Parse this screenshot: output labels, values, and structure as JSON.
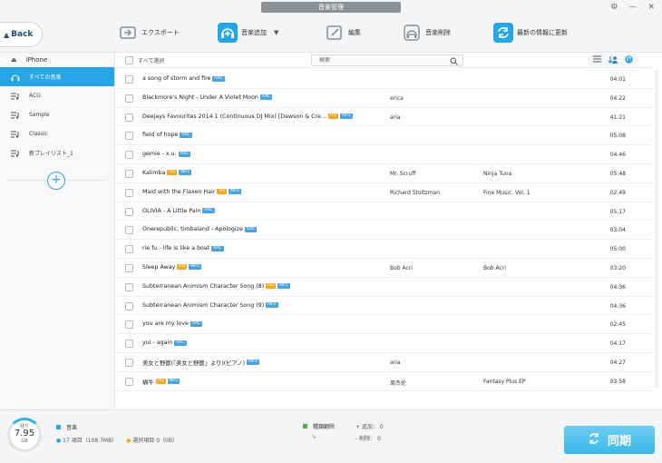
{
  "window": {
    "title": "音楽管理",
    "settings_glyph": "⚙",
    "minimize_glyph": "—",
    "close_glyph": "✕"
  },
  "toolbar": {
    "back_label": "Back",
    "export_label": "エクスポート",
    "add_label": "音楽追加",
    "edit_label": "編集",
    "delete_label": "音楽削除",
    "refresh_label": "最新の情報に更新",
    "accent_color": "#27a6e6"
  },
  "sidebar": {
    "device": "iPhone",
    "items": [
      {
        "label": "すべての音楽",
        "icon": "headphones-icon",
        "active": true
      },
      {
        "label": "ACG",
        "icon": "playlist-icon"
      },
      {
        "label": "Sample",
        "icon": "playlist-icon"
      },
      {
        "label": "Classic",
        "icon": "playlist-icon"
      },
      {
        "label": "新プレイリスト_1",
        "icon": "playlist-icon"
      }
    ],
    "add_glyph": "+"
  },
  "list": {
    "select_all": "すべて選択",
    "search_placeholder": "検索",
    "songs": [
      {
        "title": "a song of storm and fire",
        "badges": [
          "AAC"
        ],
        "artist": "",
        "album": "",
        "duration": "04:01"
      },
      {
        "title": "Blackmore's Night - Under A Violet Moon",
        "badges": [
          "AAC"
        ],
        "artist": "erica",
        "album": "",
        "duration": "04:22"
      },
      {
        "title": "Deejays Favourites 2014.1 (Continuous DJ Mix) [Dawson & Cre…",
        "badges": [
          "HQ",
          "MP3"
        ],
        "artist": "aria",
        "album": "",
        "duration": "41:21"
      },
      {
        "title": "field of hope",
        "badges": [
          "AAC"
        ],
        "artist": "",
        "album": "",
        "duration": "05:08"
      },
      {
        "title": "gemie - x.u.",
        "badges": [
          "AAC"
        ],
        "artist": "",
        "album": "",
        "duration": "04:46"
      },
      {
        "title": "Kalimba",
        "badges": [
          "HQ",
          "MP3"
        ],
        "artist": "Mr. Scruff",
        "album": "Ninja Tuna",
        "duration": "05:48"
      },
      {
        "title": "Maid with the Flaxen Hair",
        "badges": [
          "HQ",
          "MP3"
        ],
        "artist": "Richard Stoltzman",
        "album": "Fine Music, Vol. 1",
        "duration": "02:49"
      },
      {
        "title": "OLIVIA - A Little Pain",
        "badges": [
          "AAC"
        ],
        "artist": "",
        "album": "",
        "duration": "05:17"
      },
      {
        "title": "Onerepublic,  timbaland - Apologize",
        "badges": [
          "AAC"
        ],
        "artist": "",
        "album": "",
        "duration": "03:04"
      },
      {
        "title": "rie fu - life is like a boat",
        "badges": [
          "AAC"
        ],
        "artist": "",
        "album": "",
        "duration": "05:00"
      },
      {
        "title": "Sleep Away",
        "badges": [
          "HQ",
          "MP3"
        ],
        "artist": "Bob Acri",
        "album": "Bob Acri",
        "duration": "03:20"
      },
      {
        "title": "Subterranean Animism Character Song (8)",
        "badges": [
          "HQ",
          "MP3"
        ],
        "artist": "",
        "album": "",
        "duration": "04:36"
      },
      {
        "title": "Subterranean Animism Character Song (9)",
        "badges": [
          "MP3"
        ],
        "artist": "",
        "album": "",
        "duration": "04:36"
      },
      {
        "title": "you are my love",
        "badges": [
          "AAC"
        ],
        "artist": "",
        "album": "",
        "duration": "02:45"
      },
      {
        "title": "yui - again",
        "badges": [
          "AAC"
        ],
        "artist": "",
        "album": "",
        "duration": "04:17"
      },
      {
        "title": "美女と野獣(『美女と野獣』より)(ピアノ)",
        "badges": [
          "MP3"
        ],
        "artist": "aria",
        "album": "",
        "duration": "04:27"
      },
      {
        "title": "蝸牛",
        "badges": [
          "HQ",
          "MP3"
        ],
        "artist": "周杰伦",
        "album": "Fantasy Plus EP",
        "duration": "03:58"
      }
    ]
  },
  "footer": {
    "storage_label": "残り",
    "storage_value": "7.95",
    "storage_unit": "GB",
    "music_label": "音楽",
    "total_items": "17 項目（108.7MB）",
    "selected_items": "選択項目 0（0B）",
    "change_label": "種類翻除",
    "arrow": "↳",
    "add_count": "+ 追加： 0",
    "delete_count": "- 削除： 0",
    "sync_label": "同期"
  },
  "colors": {
    "hq": "#f5a623",
    "mp3": "#4aa3df",
    "aac": "#4aa3df",
    "music_square": "#27a6e6",
    "change_square": "#4caf50"
  }
}
